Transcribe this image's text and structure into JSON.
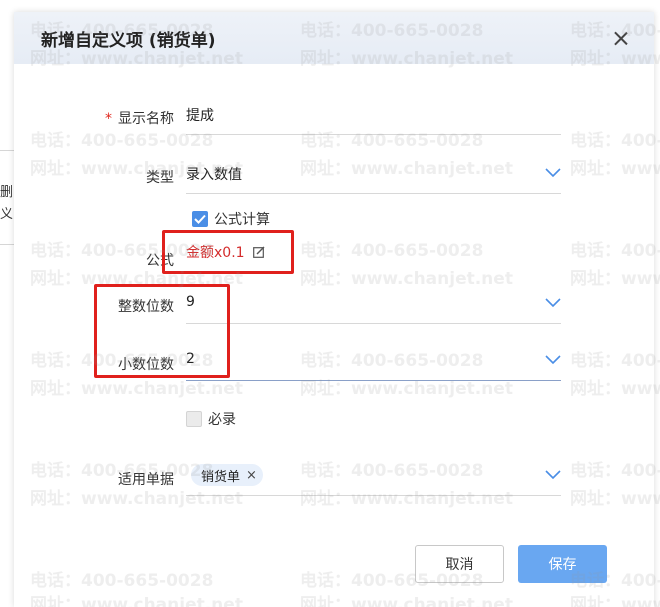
{
  "background": {
    "fragment_1": "删",
    "fragment_2": "义"
  },
  "dialog": {
    "title": "新增自定义项 (销货单)",
    "close_icon": "close-icon"
  },
  "form": {
    "required_mark": "*",
    "display_name_label": "显示名称",
    "display_name_value": "提成",
    "type_label": "类型",
    "type_value": "录入数值",
    "formula_checkbox_label": "公式计算",
    "formula_checked": true,
    "formula_label": "公式",
    "formula_value": "金额x0.1",
    "integer_digits_label": "整数位数",
    "integer_digits_value": "9",
    "decimal_digits_label": "小数位数",
    "decimal_digits_value": "2",
    "required_checkbox_label": "必录",
    "required_checked": false,
    "applicable_docs_label": "适用单据",
    "applicable_docs_tags": [
      "销货单"
    ],
    "tag_remove_symbol": "×"
  },
  "buttons": {
    "cancel": "取消",
    "save": "保存"
  },
  "watermark": {
    "phone": "电话：400-665-0028",
    "site": "网址：www.chanjet.net"
  },
  "colors": {
    "accent": "#4a8ee6",
    "save_button": "#69a7f1",
    "formula_text": "#d42c2c",
    "highlight_box": "#e0201c"
  }
}
